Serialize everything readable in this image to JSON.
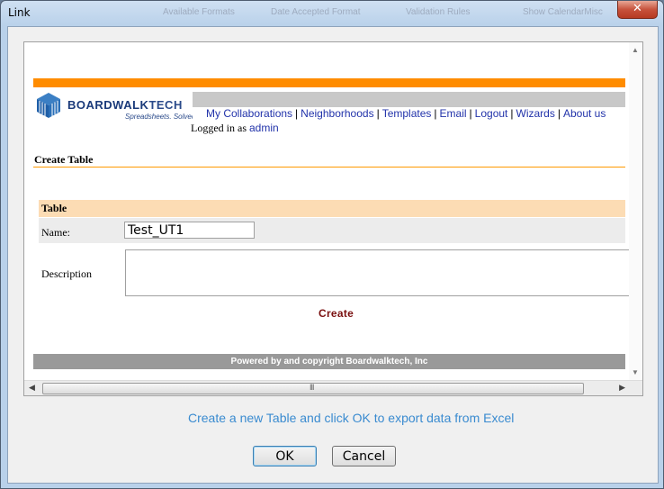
{
  "window": {
    "title": "Link",
    "close_glyph": "✕",
    "background_tabs": [
      "Available Formats",
      "Date Accepted Format",
      "Validation Rules",
      "Show CalendarMisc"
    ]
  },
  "site": {
    "brand": "BOARDWALKTECH",
    "brand_part1": "BOARDWALK",
    "brand_part2": "TECH",
    "tagline": "Spreadsheets. Solved.",
    "nav": [
      "My Collaborations",
      "Neighborhoods",
      "Templates",
      "Email",
      "Logout",
      "Wizards",
      "About us"
    ],
    "logged_in_prefix": "Logged in as",
    "user": "admin"
  },
  "form": {
    "section_title": "Create Table",
    "table_header": "Table",
    "name_label": "Name:",
    "name_value": "Test_UT1",
    "description_label": "Description",
    "description_value": "",
    "create_label": "Create"
  },
  "footer": "Powered by and copyright Boardwalktech, Inc",
  "instruction": "Create a new Table and click OK to export data from Excel",
  "buttons": {
    "ok": "OK",
    "cancel": "Cancel"
  },
  "colors": {
    "accent_orange": "#ff8c00",
    "link_blue": "#2233aa",
    "create_red": "#7a1010",
    "instruction_blue": "#3a8bd0"
  }
}
